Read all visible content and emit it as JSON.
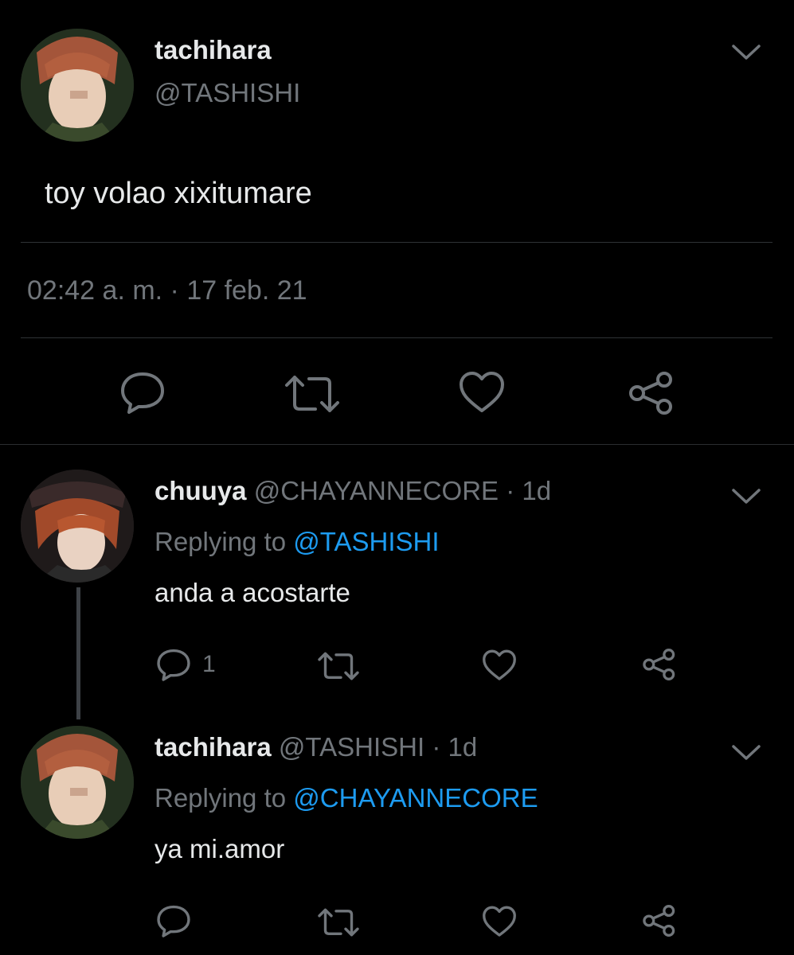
{
  "main_tweet": {
    "display_name": "tachihara",
    "handle": "@TASHISHI",
    "text": "toy volao xixitumare",
    "timestamp": "02:42 a. m. · 17 feb. 21"
  },
  "replies": [
    {
      "display_name": "chuuya",
      "handle": "@CHAYANNECORE",
      "age": "· 1d",
      "replying_prefix": "Replying to",
      "replying_handle": "@TASHISHI",
      "text": "anda a acostarte",
      "reply_count": "1"
    },
    {
      "display_name": "tachihara",
      "handle": "@TASHISHI",
      "age": "· 1d",
      "replying_prefix": "Replying to",
      "replying_handle": "@CHAYANNECORE",
      "text": "ya mi.amor",
      "reply_count": ""
    }
  ],
  "icons": {
    "reply": "reply-icon",
    "retweet": "retweet-icon",
    "like": "heart-icon",
    "share": "share-icon",
    "more": "chevron-down-icon"
  },
  "colors": {
    "background": "#000000",
    "text": "#e7e9ea",
    "muted": "#71767b",
    "link": "#1d9bf0",
    "divider": "#2f3336"
  }
}
